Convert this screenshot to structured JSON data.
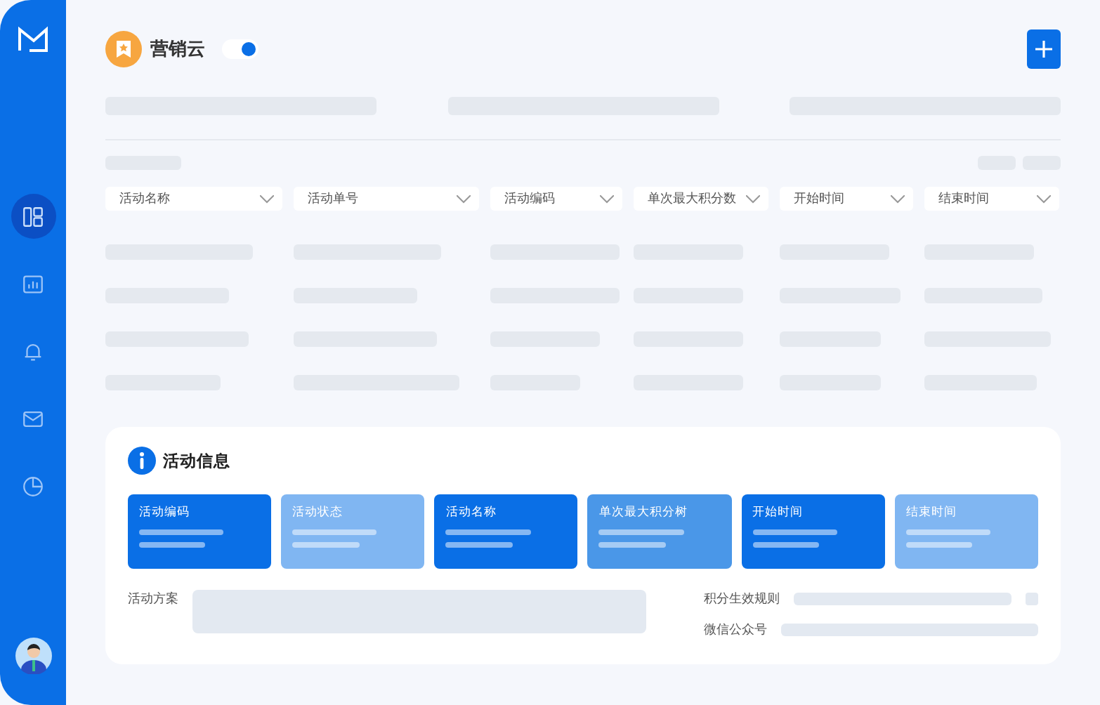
{
  "sidebar": {
    "items": [
      {
        "kind": "layout",
        "selected": true
      },
      {
        "kind": "chart",
        "selected": false
      },
      {
        "kind": "bell",
        "selected": false
      },
      {
        "kind": "mail",
        "selected": false
      },
      {
        "kind": "pie",
        "selected": false
      }
    ]
  },
  "header": {
    "title": "营销云",
    "toggle": {
      "on": true
    }
  },
  "filters": [
    {
      "label": "活动名称"
    },
    {
      "label": "活动单号"
    },
    {
      "label": "活动编码"
    },
    {
      "label": "单次最大积分数"
    },
    {
      "label": "开始时间"
    },
    {
      "label": "结束时间"
    }
  ],
  "info": {
    "title": "活动信息",
    "cards": [
      {
        "label": "活动编码",
        "color": "#0a6fe6"
      },
      {
        "label": "活动状态",
        "color": "#80b6f2"
      },
      {
        "label": "活动名称",
        "color": "#0a6fe6"
      },
      {
        "label": "单次最大积分树",
        "color": "#4a97e8"
      },
      {
        "label": "开始时间",
        "color": "#0a6fe6"
      },
      {
        "label": "结束时间",
        "color": "#80b6f2"
      }
    ],
    "fields": [
      {
        "label": "活动方案"
      },
      {
        "label": "积分生效规则"
      },
      {
        "label": "微信公众号"
      }
    ]
  }
}
